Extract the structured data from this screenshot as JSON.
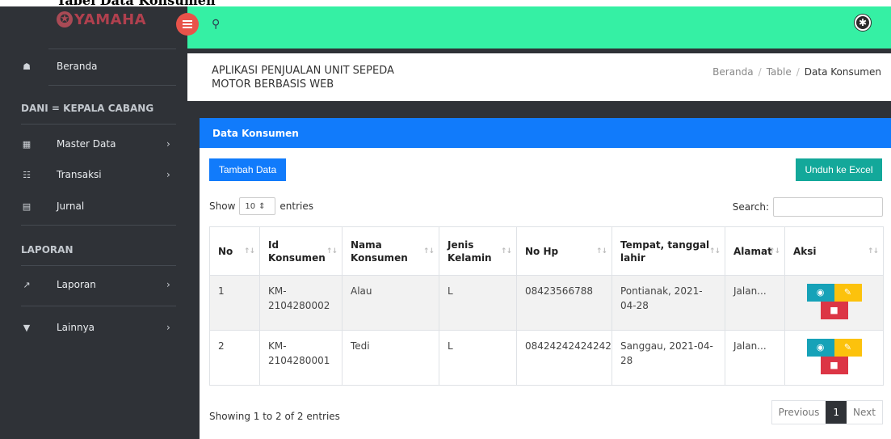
{
  "document_caption": "Tabel Data Konsumen",
  "brand": {
    "logo_text": "YAMAHA"
  },
  "sidebar": {
    "home": {
      "label": "Beranda",
      "icon": "home-icon"
    },
    "user_heading": "DANI = KEPALA CABANG",
    "items": [
      {
        "label": "Master Data",
        "icon": "grid-icon",
        "chevron": "›"
      },
      {
        "label": "Transaksi",
        "icon": "cart-icon",
        "chevron": "›"
      },
      {
        "label": "Jurnal",
        "icon": "list-icon",
        "chevron": ""
      }
    ],
    "report_heading": "LAPORAN",
    "report_items": [
      {
        "label": "Laporan",
        "icon": "chart-icon",
        "chevron": "›"
      },
      {
        "label": "Lainnya",
        "icon": "filter-icon",
        "chevron": "›"
      }
    ]
  },
  "header": {
    "app_title": "APLIKASI PENJUALAN UNIT SEPEDA MOTOR BERBASIS WEB",
    "breadcrumb": [
      "Beranda",
      "Table",
      "Data Konsumen"
    ]
  },
  "card": {
    "title": "Data Konsumen",
    "add_button": "Tambah Data",
    "excel_button": "Unduh ke Excel",
    "length": {
      "show": "Show",
      "value": "10",
      "entries": "entries"
    },
    "search_label": "Search:",
    "columns": [
      "No",
      "Id Konsumen",
      "Nama Konsumen",
      "Jenis Kelamin",
      "No Hp",
      "Tempat, tanggal lahir",
      "Alamat",
      "Aksi"
    ],
    "rows": [
      {
        "no": "1",
        "id": "KM-2104280002",
        "nama": "Alau",
        "jk": "L",
        "hp": "08423566788",
        "ttl": "Pontianak, 2021-04-28",
        "alamat": "Jalan..."
      },
      {
        "no": "2",
        "id": "KM-2104280001",
        "nama": "Tedi",
        "jk": "L",
        "hp": "08424242424242",
        "ttl": "Sanggau, 2021-04-28",
        "alamat": "Jalan..."
      }
    ],
    "info": "Showing 1 to 2 of 2 entries",
    "pager": {
      "previous": "Previous",
      "current": "1",
      "next": "Next"
    }
  },
  "colors": {
    "topbar": "#35f0a4",
    "sidebar": "#2f3237",
    "primary": "#117bfb",
    "excel": "#13a89a",
    "toggle": "#e8534a"
  }
}
